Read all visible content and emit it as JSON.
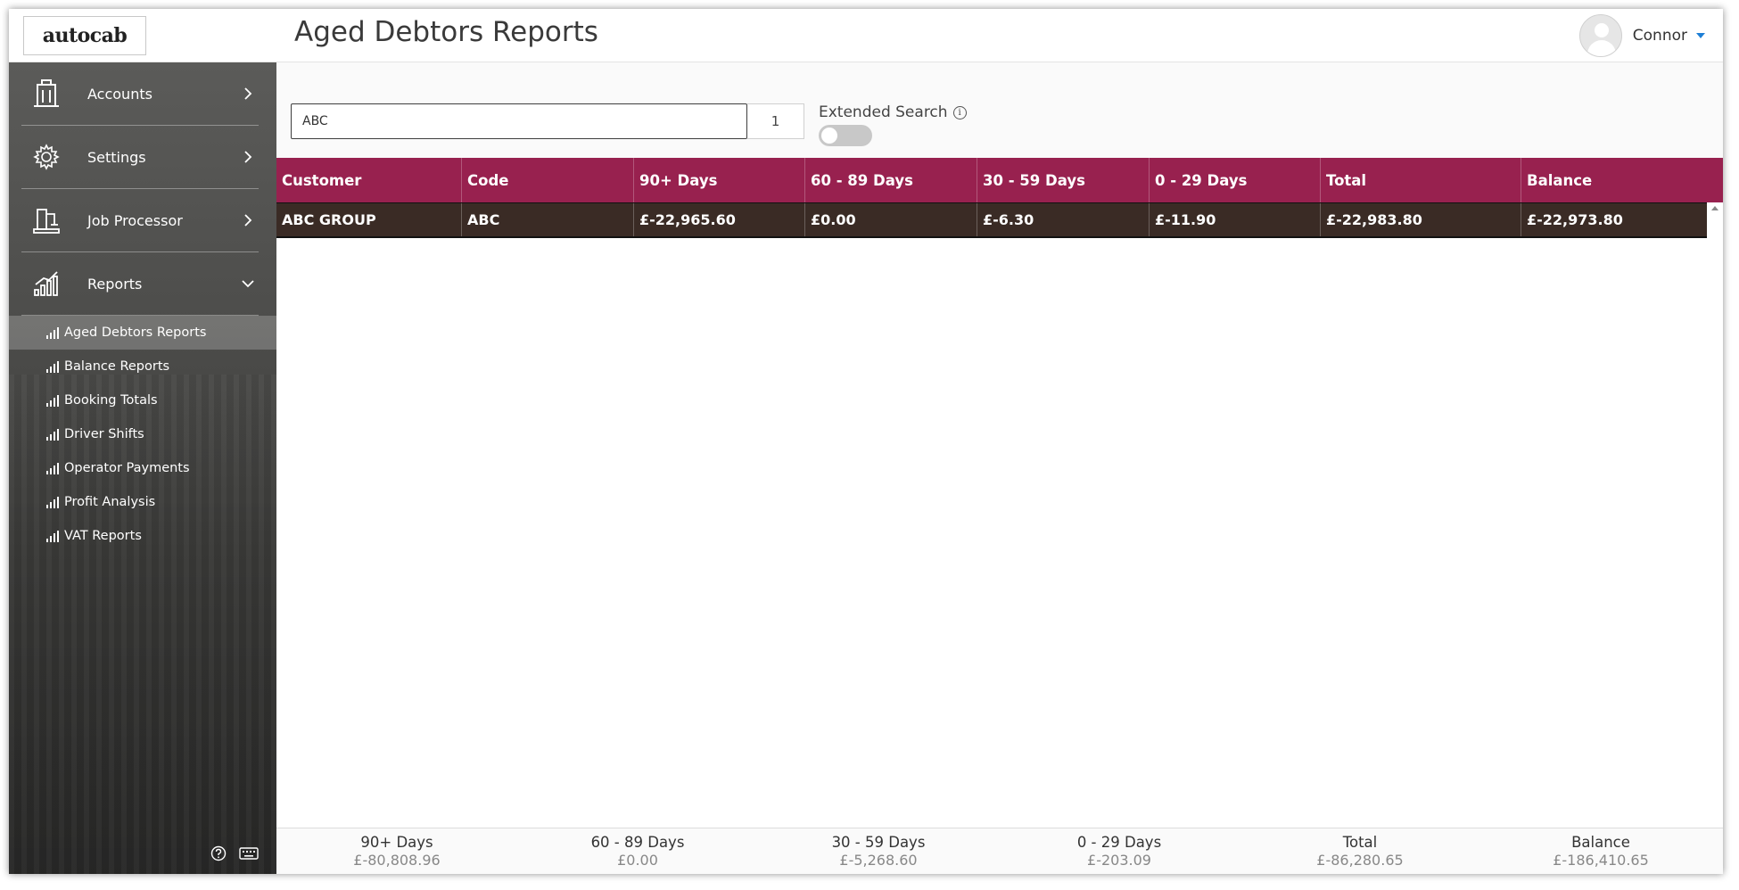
{
  "app": {
    "logo_text": "autocab",
    "page_title": "Aged Debtors Reports",
    "user_name": "Connor"
  },
  "sidebar": {
    "sections": [
      {
        "label": "Accounts",
        "icon": "building-icon",
        "expanded": false
      },
      {
        "label": "Settings",
        "icon": "gear-icon",
        "expanded": false
      },
      {
        "label": "Job Processor",
        "icon": "job-processor-icon",
        "expanded": false
      },
      {
        "label": "Reports",
        "icon": "chart-icon",
        "expanded": true
      }
    ],
    "report_items": [
      {
        "label": "Aged Debtors Reports",
        "active": true
      },
      {
        "label": "Balance Reports",
        "active": false
      },
      {
        "label": "Booking Totals",
        "active": false
      },
      {
        "label": "Driver Shifts",
        "active": false
      },
      {
        "label": "Operator Payments",
        "active": false
      },
      {
        "label": "Profit Analysis",
        "active": false
      },
      {
        "label": "VAT Reports",
        "active": false
      }
    ],
    "footer_icons": [
      "help-icon",
      "keyboard-icon"
    ]
  },
  "search": {
    "value": "ABC",
    "page_number": "1",
    "extended_search_label": "Extended Search",
    "extended_search_enabled": false
  },
  "table": {
    "columns": [
      "Customer",
      "Code",
      "90+ Days",
      "60 - 89 Days",
      "30 - 59 Days",
      "0 - 29 Days",
      "Total",
      "Balance"
    ],
    "rows": [
      [
        "ABC GROUP",
        "ABC",
        "£-22,965.60",
        "£0.00",
        "£-6.30",
        "£-11.90",
        "£-22,983.80",
        "£-22,973.80"
      ]
    ]
  },
  "totals": [
    {
      "label": "90+ Days",
      "value": "£-80,808.96"
    },
    {
      "label": "60 - 89 Days",
      "value": "£0.00"
    },
    {
      "label": "30 - 59 Days",
      "value": "£-5,268.60"
    },
    {
      "label": "0 - 29 Days",
      "value": "£-203.09"
    },
    {
      "label": "Total",
      "value": "£-86,280.65"
    },
    {
      "label": "Balance",
      "value": "£-186,410.65"
    }
  ],
  "colors": {
    "header_bg": "#98214f",
    "row_bg": "#3a2b25",
    "accent": "#1e7fd6"
  }
}
